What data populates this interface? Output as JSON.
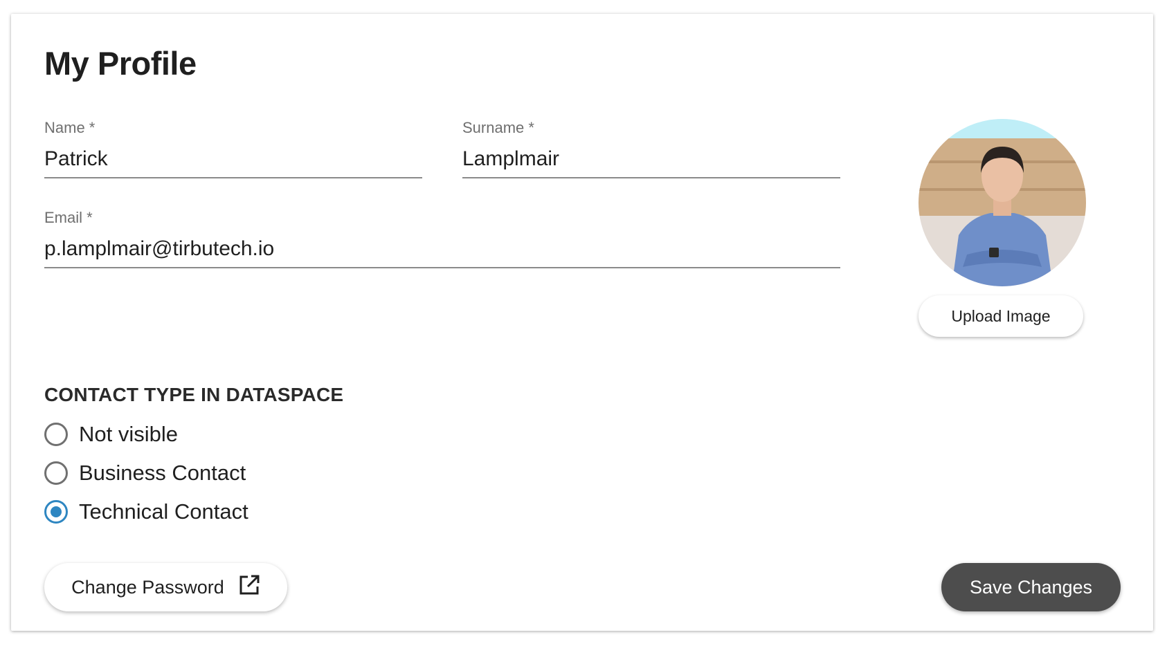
{
  "profile": {
    "title": "My Profile",
    "name_label": "Name *",
    "name_value": "Patrick",
    "surname_label": "Surname *",
    "surname_value": "Lamplmair",
    "email_label": "Email *",
    "email_value": "p.lamplmair@tirbutech.io",
    "upload_label": "Upload Image"
  },
  "contact_type": {
    "heading": "CONTACT TYPE IN DATASPACE",
    "options": [
      {
        "label": "Not visible",
        "checked": false
      },
      {
        "label": "Business Contact",
        "checked": false
      },
      {
        "label": "Technical Contact",
        "checked": true
      }
    ]
  },
  "actions": {
    "change_password_label": "Change Password",
    "change_password_icon": "open-in-new-icon",
    "save_label": "Save Changes"
  },
  "colors": {
    "accent": "#2e86c1",
    "save_button_bg": "#4d4d4d"
  }
}
